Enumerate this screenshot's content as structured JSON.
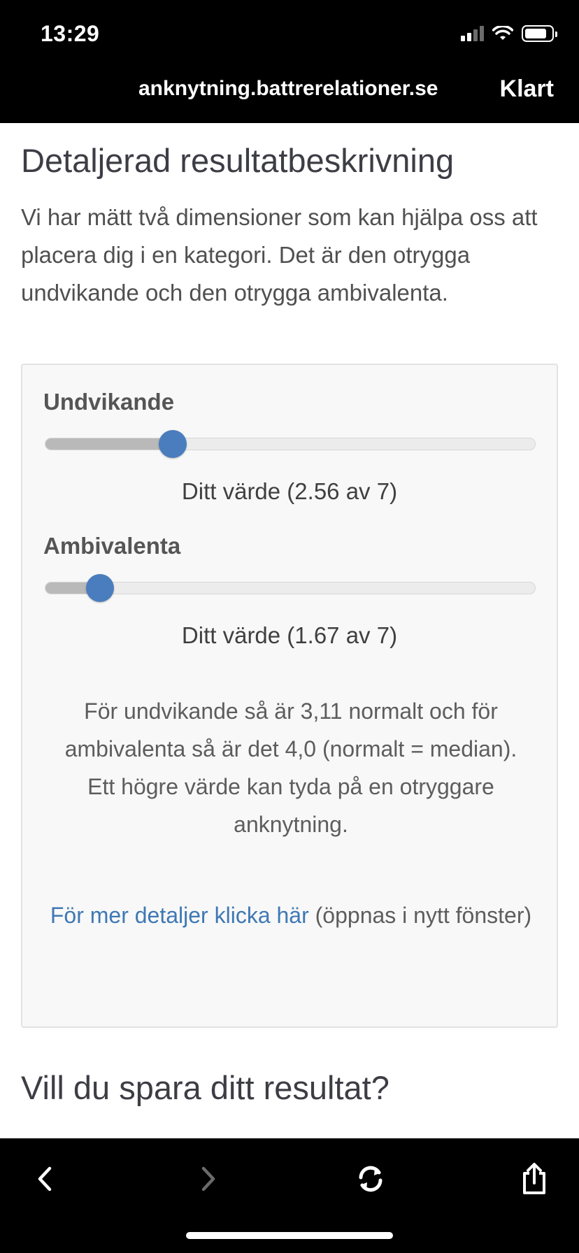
{
  "status_bar": {
    "time": "13:29"
  },
  "browser": {
    "url": "anknytning.battrerelationer.se",
    "done_label": "Klart"
  },
  "page": {
    "heading": "Detaljerad resultatbeskrivning",
    "intro": "Vi har mätt två dimensioner som kan hjälpa oss att placera dig i en kategori. Det är den otrygga undvikande och den otrygga ambivalenta.",
    "dimensions": [
      {
        "label": "Undvikande",
        "value_text": "Ditt värde (2.56 av 7)",
        "value": 2.56,
        "max": 7
      },
      {
        "label": "Ambivalenta",
        "value_text": "Ditt värde (1.67 av 7)",
        "value": 1.67,
        "max": 7
      }
    ],
    "norm_note_line1": "För undvikande så är 3,11 normalt och för ambivalenta så är det 4,0 (normalt = median).",
    "norm_note_line2": "Ett högre värde kan tyda på en otryggare anknytning.",
    "details_link": "För mer detaljer klicka här",
    "details_suffix": " (öppnas i nytt fönster)",
    "save_heading": "Vill du spara ditt resultat?"
  },
  "colors": {
    "accent": "#4a7dbd",
    "link": "#3f78b4",
    "bar_background": "#000000"
  },
  "toolbar": {
    "icons": [
      "back-icon",
      "forward-icon",
      "reload-icon",
      "share-icon"
    ]
  }
}
